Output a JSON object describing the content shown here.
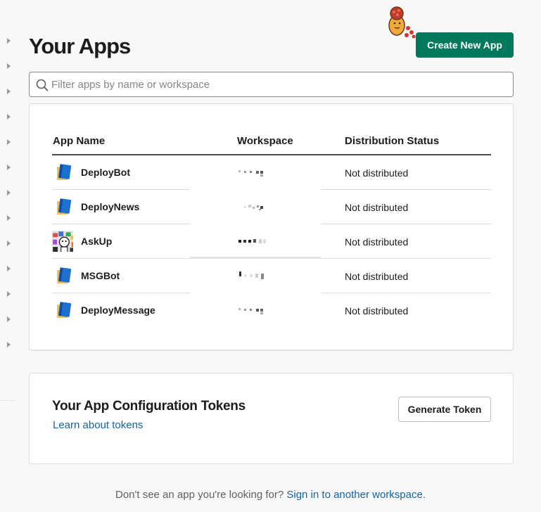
{
  "page": {
    "title": "Your Apps",
    "create_button": "Create New App"
  },
  "search": {
    "placeholder": "Filter apps by name or workspace",
    "value": ""
  },
  "apps_table": {
    "columns": [
      "App Name",
      "Workspace",
      "Distribution Status"
    ],
    "rows": [
      {
        "name": "DeployBot",
        "icon": "blue-book-icon",
        "status": "Not distributed"
      },
      {
        "name": "DeployNews",
        "icon": "blue-book-icon",
        "status": "Not distributed"
      },
      {
        "name": "AskUp",
        "icon": "askup-avatar-icon",
        "status": "Not distributed"
      },
      {
        "name": "MSGBot",
        "icon": "blue-book-icon",
        "status": "Not distributed"
      },
      {
        "name": "DeployMessage",
        "icon": "blue-book-icon",
        "status": "Not distributed"
      }
    ]
  },
  "tokens": {
    "title": "Your App Configuration Tokens",
    "link": "Learn about tokens",
    "button": "Generate Token"
  },
  "footer": {
    "text": "Don't see an app you're looking for? ",
    "link": "Sign in to another workspace",
    "end": "."
  },
  "colors": {
    "primary_button": "#007a5a",
    "link": "#1264a3",
    "text": "#1d1c1d"
  }
}
